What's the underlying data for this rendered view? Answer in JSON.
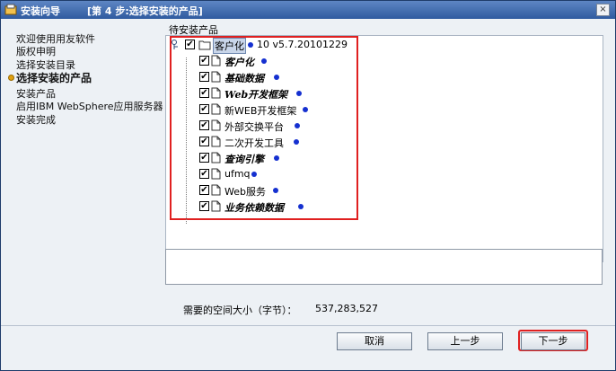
{
  "window": {
    "app_title": "安装向导",
    "step_title": "[第 4 步:选择安装的产品]",
    "close_label": "×"
  },
  "sidebar": {
    "items": [
      {
        "label": "欢迎使用用友软件",
        "active": false
      },
      {
        "label": "版权申明",
        "active": false
      },
      {
        "label": "选择安装目录",
        "active": false
      },
      {
        "label": "选择安装的产品",
        "active": true
      },
      {
        "label": "安装产品",
        "active": false
      },
      {
        "label": "启用IBM WebSphere应用服务器",
        "active": false
      },
      {
        "label": "安装完成",
        "active": false
      }
    ]
  },
  "main": {
    "panel_title": "待安装产品",
    "tree": {
      "root": {
        "label": "客户化",
        "extra": "10 v5.7.20101229",
        "checked": true
      },
      "children": [
        {
          "label": "客户化",
          "style": "bold-italic",
          "checked": true
        },
        {
          "label": "基础数据",
          "style": "bold-italic",
          "checked": true
        },
        {
          "label": "Web开发框架",
          "style": "bold-italic",
          "checked": true
        },
        {
          "label": "新WEB开发框架",
          "style": "normal",
          "checked": true
        },
        {
          "label": "外部交换平台",
          "style": "normal",
          "checked": true
        },
        {
          "label": "二次开发工具",
          "style": "normal",
          "checked": true
        },
        {
          "label": "查询引擎",
          "style": "bold-italic",
          "checked": true
        },
        {
          "label": "ufmq",
          "style": "normal",
          "checked": true
        },
        {
          "label": "Web服务",
          "style": "normal",
          "checked": true
        },
        {
          "label": "业务依赖数据",
          "style": "bold-italic",
          "checked": true
        }
      ]
    },
    "space_label": "需要的空间大小（字节）：",
    "space_value": "537,283,527"
  },
  "buttons": {
    "cancel": "取消",
    "prev": "上一步",
    "next": "下一步"
  },
  "colors": {
    "highlight_border": "#e02020",
    "status_dot": "#1530d0",
    "titlebar": "#2f5b9f"
  }
}
